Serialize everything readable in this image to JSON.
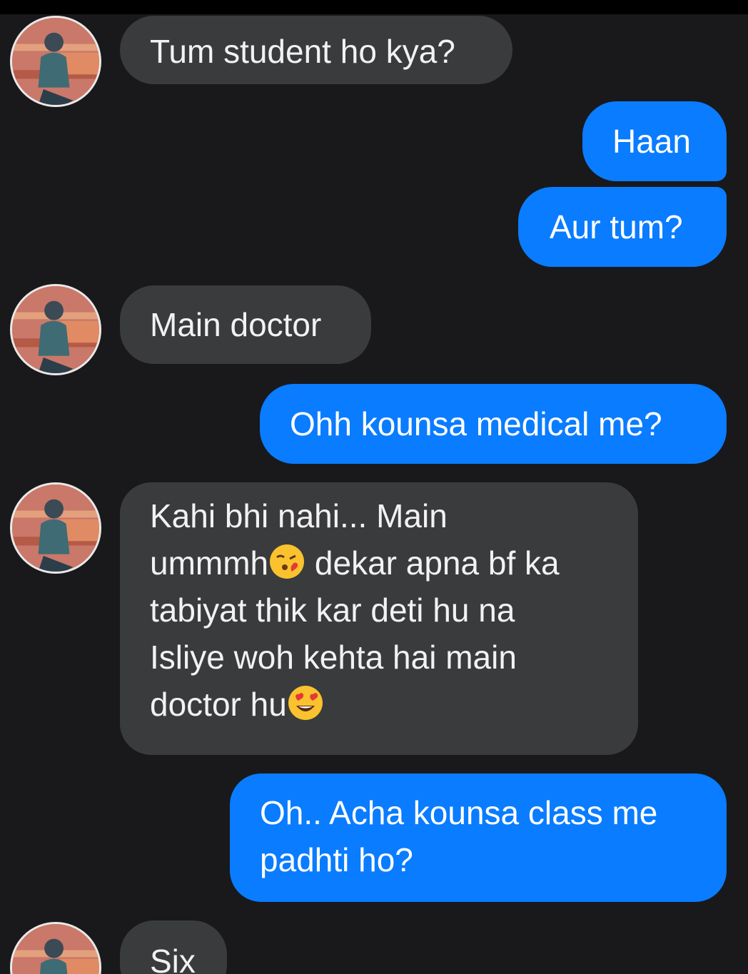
{
  "conversation": {
    "messages": [
      {
        "direction": "incoming",
        "lines": [
          "Tum student ho kya?"
        ]
      },
      {
        "direction": "outgoing",
        "lines": [
          "Haan"
        ]
      },
      {
        "direction": "outgoing",
        "lines": [
          "Aur tum?"
        ]
      },
      {
        "direction": "incoming",
        "lines": [
          "Main doctor"
        ]
      },
      {
        "direction": "outgoing",
        "lines": [
          "Ohh kounsa medical me?"
        ]
      },
      {
        "direction": "incoming",
        "lines": [
          "Kahi bhi nahi... Main",
          "ummmh",
          "dekar apna bf ka",
          "tabiyat thik kar deti hu na",
          "Isliye woh kehta hai main",
          "doctor hu"
        ]
      },
      {
        "direction": "outgoing",
        "lines": [
          "Oh.. Acha kounsa class me",
          "padhti ho?"
        ]
      },
      {
        "direction": "incoming",
        "lines": [
          "Six"
        ]
      }
    ],
    "emojis": {
      "kiss": "face-blowing-a-kiss-icon",
      "heart_eyes": "smiling-face-with-heart-eyes-icon"
    }
  },
  "colors": {
    "background": "#19191b",
    "incoming_bubble": "#3a3b3d",
    "outgoing_bubble": "#0a7cff"
  }
}
